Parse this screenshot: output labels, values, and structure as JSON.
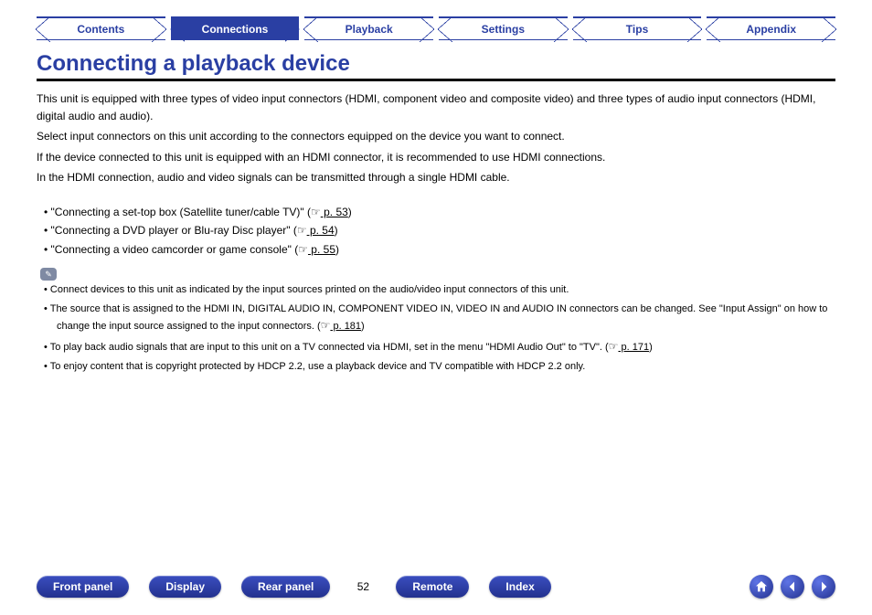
{
  "tabs": [
    {
      "label": "Contents",
      "active": false
    },
    {
      "label": "Connections",
      "active": true
    },
    {
      "label": "Playback",
      "active": false
    },
    {
      "label": "Settings",
      "active": false
    },
    {
      "label": "Tips",
      "active": false
    },
    {
      "label": "Appendix",
      "active": false
    }
  ],
  "title": "Connecting a playback device",
  "paragraphs": [
    "This unit is equipped with three types of video input connectors (HDMI, component video and composite video) and three types of audio input connectors (HDMI, digital audio and audio).",
    "Select input connectors on this unit according to the connectors equipped on the device you want to connect.",
    "If the device connected to this unit is equipped with an HDMI connector, it is recommended to use HDMI connections.",
    "In the HDMI connection, audio and video signals can be transmitted through a single HDMI cable."
  ],
  "primary_list": [
    {
      "text_pre": "\"Connecting a set-top box (Satellite tuner/cable TV)\" (",
      "link": " p. 53",
      "text_post": ")"
    },
    {
      "text_pre": "\"Connecting a DVD player or Blu-ray Disc player\" (",
      "link": " p. 54",
      "text_post": ")"
    },
    {
      "text_pre": "\"Connecting a video camcorder or game console\" (",
      "link": " p. 55",
      "text_post": ")"
    }
  ],
  "notes": [
    {
      "text": "Connect devices to this unit as indicated by the input sources printed on the audio/video input connectors of this unit."
    },
    {
      "text": "The source that is assigned to the HDMI IN, DIGITAL AUDIO IN, COMPONENT VIDEO IN, VIDEO IN and AUDIO IN connectors can be changed. See \"Input Assign\" on how to change the input source assigned to the input connectors.  (",
      "link": " p. 181",
      "text_post": ")"
    },
    {
      "text": "To play back audio signals that are input to this unit on a TV connected via HDMI, set in the menu \"HDMI Audio Out\" to \"TV\".  (",
      "link": " p. 171",
      "text_post": ")"
    },
    {
      "text": "To enjoy content that is copyright protected by HDCP 2.2, use a playback device and TV compatible with HDCP 2.2 only."
    }
  ],
  "footer": {
    "buttons": [
      "Front panel",
      "Display",
      "Rear panel"
    ],
    "page_num": "52",
    "buttons_right": [
      "Remote",
      "Index"
    ],
    "nav": {
      "home": "home-icon",
      "prev": "prev-icon",
      "next": "next-icon"
    }
  },
  "pointer_glyph": "☞"
}
